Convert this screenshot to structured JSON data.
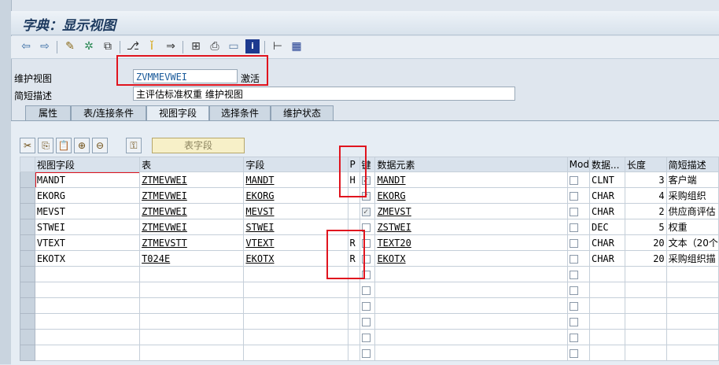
{
  "title": "字典：显示视图",
  "toolbar": {
    "icons": [
      "back-arrow-icon",
      "forward-arrow-icon",
      "edit-icon",
      "display-change-icon",
      "activate-icon",
      "where-used-icon",
      "info-icon",
      "navigate-icon",
      "hierarchy-icon",
      "print-icon",
      "layout-icon",
      "info-box-icon",
      "tree-icon",
      "grid-icon"
    ]
  },
  "header": {
    "view_label": "维护视图",
    "view_value": "ZVMMEVWEI",
    "status": "激活",
    "desc_label": "简短描述",
    "desc_value": "主评估标准权重 维护视图"
  },
  "tabs": [
    {
      "label": "属性"
    },
    {
      "label": "表/连接条件"
    },
    {
      "label": "视图字段",
      "active": true
    },
    {
      "label": "选择条件"
    },
    {
      "label": "维护状态"
    }
  ],
  "grid_toolbar": {
    "table_field_button": "表字段"
  },
  "columns": [
    "视图字段",
    "表",
    "字段",
    "P",
    "键",
    "数据元素",
    "Mod",
    "数据...",
    "长度",
    "简短描述"
  ],
  "rows": [
    {
      "view_field": "MANDT",
      "table": "ZTMEVWEI",
      "field": "MANDT",
      "p": "H",
      "key": true,
      "element": "MANDT",
      "mod": false,
      "type": "CLNT",
      "length": "3",
      "desc": "客户端"
    },
    {
      "view_field": "EKORG",
      "table": "ZTMEVWEI",
      "field": "EKORG",
      "p": "",
      "key": true,
      "element": "EKORG",
      "mod": false,
      "type": "CHAR",
      "length": "4",
      "desc": "采购组织"
    },
    {
      "view_field": "MEVST",
      "table": "ZTMEVWEI",
      "field": "MEVST",
      "p": "",
      "key": true,
      "element": "ZMEVST",
      "mod": false,
      "type": "CHAR",
      "length": "2",
      "desc": "供应商评估"
    },
    {
      "view_field": "STWEI",
      "table": "ZTMEVWEI",
      "field": "STWEI",
      "p": "",
      "key": false,
      "element": "ZSTWEI",
      "mod": false,
      "type": "DEC",
      "length": "5",
      "desc": "权重"
    },
    {
      "view_field": "VTEXT",
      "table": "ZTMEVSTT",
      "field": "VTEXT",
      "p": "R",
      "key": false,
      "element": "TEXT20",
      "mod": false,
      "type": "CHAR",
      "length": "20",
      "desc": "文本（20个"
    },
    {
      "view_field": "EKOTX",
      "table": "T024E",
      "field": "EKOTX",
      "p": "R",
      "key": false,
      "element": "EKOTX",
      "mod": false,
      "type": "CHAR",
      "length": "20",
      "desc": "采购组织描"
    }
  ],
  "empty_rows": 6
}
